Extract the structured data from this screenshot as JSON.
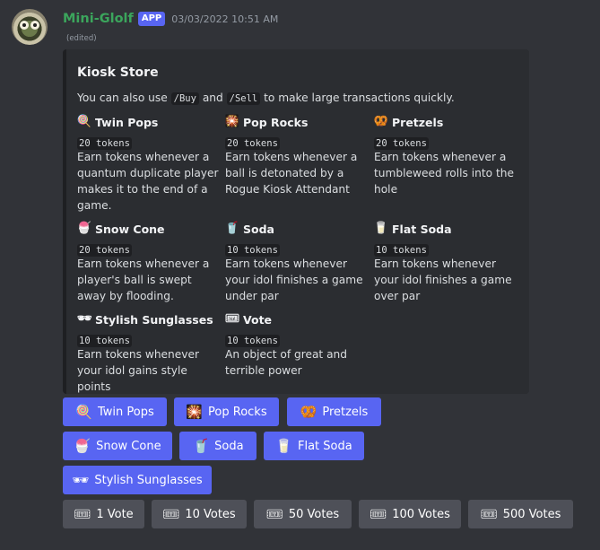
{
  "message": {
    "username": "Mini-Glolf",
    "badge": "APP",
    "timestamp": "03/03/2022 10:51 AM",
    "edited": "(edited)",
    "avatar": "golf-ball-character-avatar"
  },
  "embed": {
    "title": "Kiosk Store",
    "desc_prefix": "You can also use",
    "desc_cmd1": "/Buy",
    "desc_and": "and",
    "desc_cmd2": "/Sell",
    "desc_suffix": "to make large transactions quickly.",
    "fields": [
      {
        "icon": "popsicle-icon",
        "glyph": "🍭",
        "name": "Twin Pops",
        "tokens": "20 tokens",
        "desc": "Earn tokens whenever a quantum duplicate player makes it to the end of a game."
      },
      {
        "icon": "sparkler-icon",
        "glyph": "🎇",
        "name": "Pop Rocks",
        "tokens": "20 tokens",
        "desc": "Earn tokens whenever a ball is detonated by a Rogue Kiosk Attendant"
      },
      {
        "icon": "pretzel-icon",
        "glyph": "🥨",
        "name": "Pretzels",
        "tokens": "20 tokens",
        "desc": "Earn tokens whenever a tumbleweed rolls into the hole"
      },
      {
        "icon": "shaved-ice-icon",
        "glyph": "🍧",
        "name": "Snow Cone",
        "tokens": "20 tokens",
        "desc": "Earn tokens whenever a player's ball is swept away by flooding."
      },
      {
        "icon": "cup-with-straw-icon",
        "glyph": "🥤",
        "name": "Soda",
        "tokens": "10 tokens",
        "desc": "Earn tokens whenever your idol finishes a game under par"
      },
      {
        "icon": "glass-icon",
        "glyph": "🥛",
        "name": "Flat Soda",
        "tokens": "10 tokens",
        "desc": "Earn tokens whenever your idol finishes a game over par"
      },
      {
        "icon": "sunglasses-icon",
        "glyph": "🕶",
        "name": "Stylish Sunglasses",
        "tokens": "10 tokens",
        "desc": "Earn tokens whenever your idol gains style points"
      },
      {
        "icon": "ticket-icon",
        "glyph": "🎟",
        "name": "Vote",
        "tokens": "10 tokens",
        "desc": "An object of great and terrible power"
      }
    ]
  },
  "buttons": {
    "row1": [
      {
        "icon": "popsicle-icon",
        "glyph": "🍭",
        "label": "Twin Pops"
      },
      {
        "icon": "sparkler-icon",
        "glyph": "🎇",
        "label": "Pop Rocks"
      },
      {
        "icon": "pretzel-icon",
        "glyph": "🥨",
        "label": "Pretzels"
      }
    ],
    "row2": [
      {
        "icon": "shaved-ice-icon",
        "glyph": "🍧",
        "label": "Snow Cone"
      },
      {
        "icon": "cup-with-straw-icon",
        "glyph": "🥤",
        "label": "Soda"
      },
      {
        "icon": "glass-icon",
        "glyph": "🥛",
        "label": "Flat Soda"
      }
    ],
    "row3": [
      {
        "icon": "sunglasses-icon",
        "glyph": "🕶",
        "label": "Stylish Sunglasses"
      }
    ],
    "row4": [
      {
        "icon": "ticket-icon",
        "glyph": "🎟",
        "label": "1 Vote"
      },
      {
        "icon": "ticket-icon",
        "glyph": "🎟",
        "label": "10 Votes"
      },
      {
        "icon": "ticket-icon",
        "glyph": "🎟",
        "label": "50 Votes"
      },
      {
        "icon": "ticket-icon",
        "glyph": "🎟",
        "label": "100 Votes"
      },
      {
        "icon": "ticket-icon",
        "glyph": "🎟",
        "label": "500 Votes"
      }
    ]
  },
  "colors": {
    "background": "#313338",
    "embed_bg": "#2b2d31",
    "username": "#3ba55c",
    "primary_button": "#5865f2",
    "secondary_button": "#4e5058"
  }
}
